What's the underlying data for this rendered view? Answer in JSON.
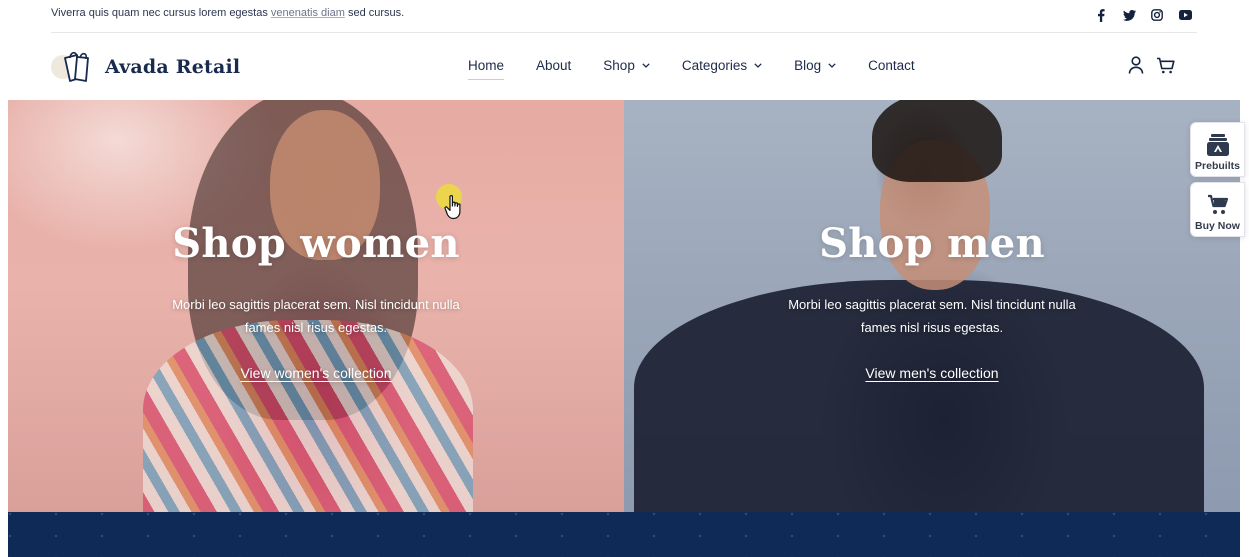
{
  "topbar": {
    "message_before": "Viverra quis quam nec cursus lorem egestas ",
    "message_link": "venenatis diam",
    "message_after": " sed cursus.",
    "social_icons": [
      "facebook-icon",
      "twitter-icon",
      "instagram-icon",
      "youtube-icon"
    ]
  },
  "header": {
    "brand": "Avada Retail",
    "nav": [
      {
        "label": "Home",
        "active": true
      },
      {
        "label": "About"
      },
      {
        "label": "Shop",
        "dropdown": true
      },
      {
        "label": "Categories",
        "dropdown": true
      },
      {
        "label": "Blog",
        "dropdown": true
      },
      {
        "label": "Contact"
      }
    ],
    "icons": [
      "user-icon",
      "cart-icon"
    ]
  },
  "hero": {
    "women": {
      "title": "Shop women",
      "text": "Morbi leo sagittis placerat sem. Nisl tincidunt nulla fames nisl risus egestas.",
      "link": "View women's collection"
    },
    "men": {
      "title": "Shop men",
      "text": "Morbi leo sagittis placerat sem. Nisl tincidunt nulla fames nisl risus egestas.",
      "link": "View men's collection"
    }
  },
  "side_widgets": {
    "prebuilts": "Prebuilts",
    "buy_now": "Buy Now"
  },
  "colors": {
    "navy": "#102a57",
    "text": "#1c2b4a",
    "cursor_highlight": "#eadc3c"
  }
}
